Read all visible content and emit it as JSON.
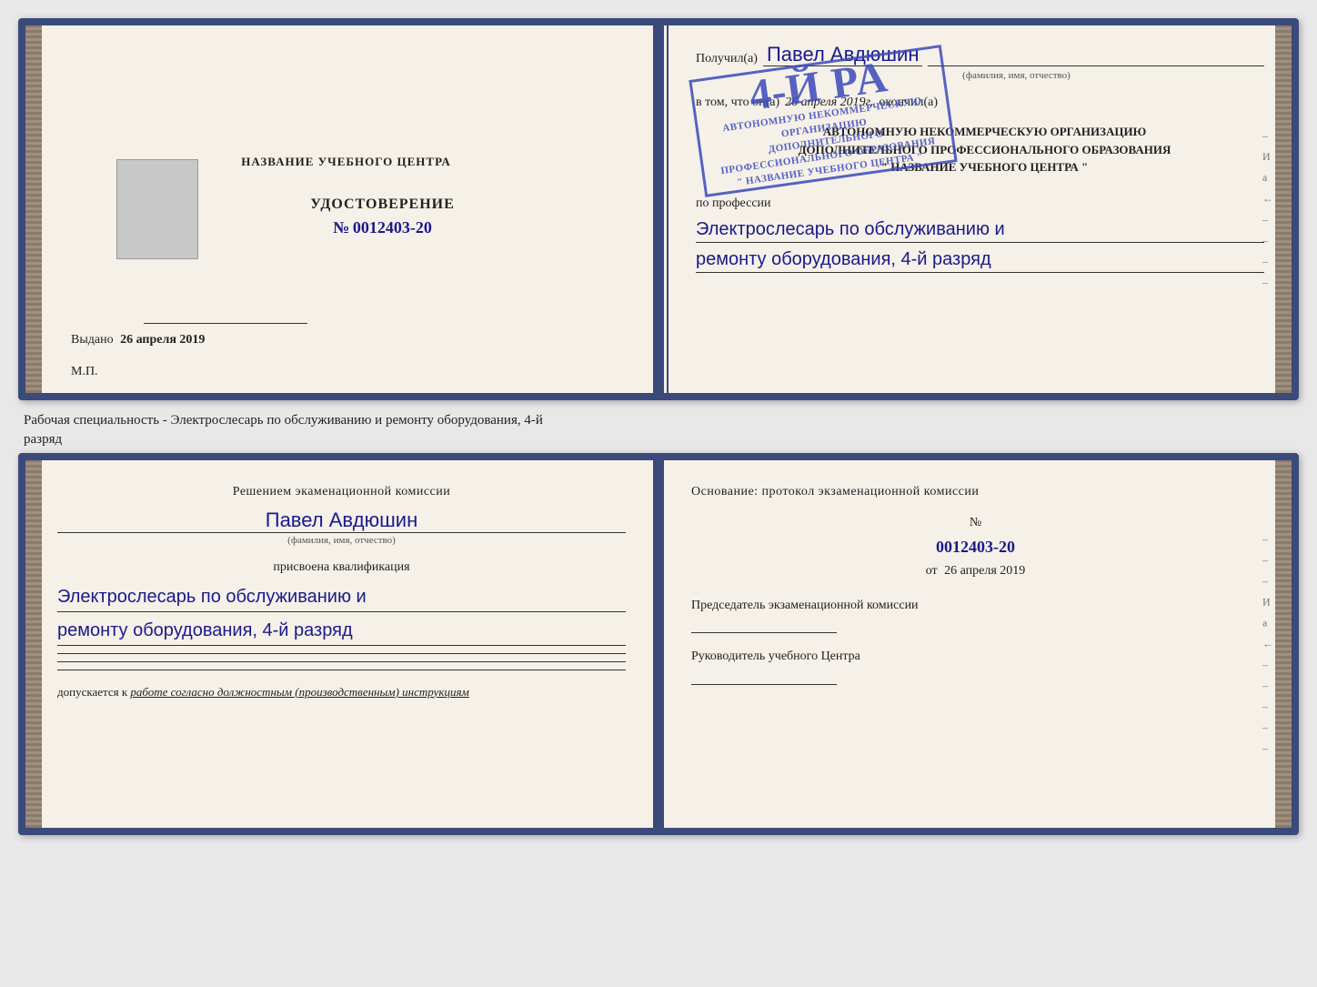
{
  "top_book": {
    "left_page": {
      "school_name": "НАЗВАНИЕ УЧЕБНОГО ЦЕНТРА",
      "cert_title": "УДОСТОВЕРЕНИЕ",
      "cert_number_prefix": "№",
      "cert_number": "0012403-20",
      "issued_label": "Выдано",
      "issued_date": "26 апреля 2019",
      "mp_label": "М.П."
    },
    "right_page": {
      "received_label": "Получил(а)",
      "person_name": "Павел Авдюшин",
      "fio_hint": "(фамилия, имя, отчество)",
      "in_that_label": "в том, что он(а)",
      "date_label": "26 апреля 2019г.",
      "finished_label": "окончил(а)",
      "stamp_line1": "4-й pa",
      "org_line1": "АВТОНОМНУЮ НЕКОММЕРЧЕСКУЮ ОРГАНИЗАЦИЮ",
      "org_line2": "ДОПОЛНИТЕЛЬНОГО ПРОФЕССИОНАЛЬНОГО ОБРАЗОВАНИЯ",
      "org_name": "\" НАЗВАНИЕ УЧЕБНОГО ЦЕНТРА \"",
      "profession_label": "по профессии",
      "profession_line1": "Электрослесарь по обслуживанию и",
      "profession_line2": "ремонту оборудования, 4-й разряд"
    }
  },
  "between_label": {
    "line1": "Рабочая специальность - Электрослесарь по обслуживанию и ремонту оборудования, 4-й",
    "line2": "разряд"
  },
  "bottom_book": {
    "left_page": {
      "commission_text": "Решением экаменационной комиссии",
      "person_name": "Павел Авдюшин",
      "fio_hint": "(фамилия, имя, отчество)",
      "assigned_label": "присвоена квалификация",
      "qual_line1": "Электрослесарь по обслуживанию и",
      "qual_line2": "ремонту оборудования, 4-й разряд",
      "allowed_prefix": "допускается к",
      "allowed_text": "работе согласно должностным (производственным) инструкциям"
    },
    "right_page": {
      "basis_label": "Основание: протокол экзаменационной комиссии",
      "number_prefix": "№",
      "protocol_number": "0012403-20",
      "from_label": "от",
      "from_date": "26 апреля 2019",
      "chairman_label": "Председатель экзаменационной комиссии",
      "director_label": "Руководитель учебного Центра"
    }
  },
  "right_edge": {
    "chars": [
      "И",
      "а",
      "←",
      "–",
      "–",
      "–",
      "–",
      "–"
    ]
  }
}
